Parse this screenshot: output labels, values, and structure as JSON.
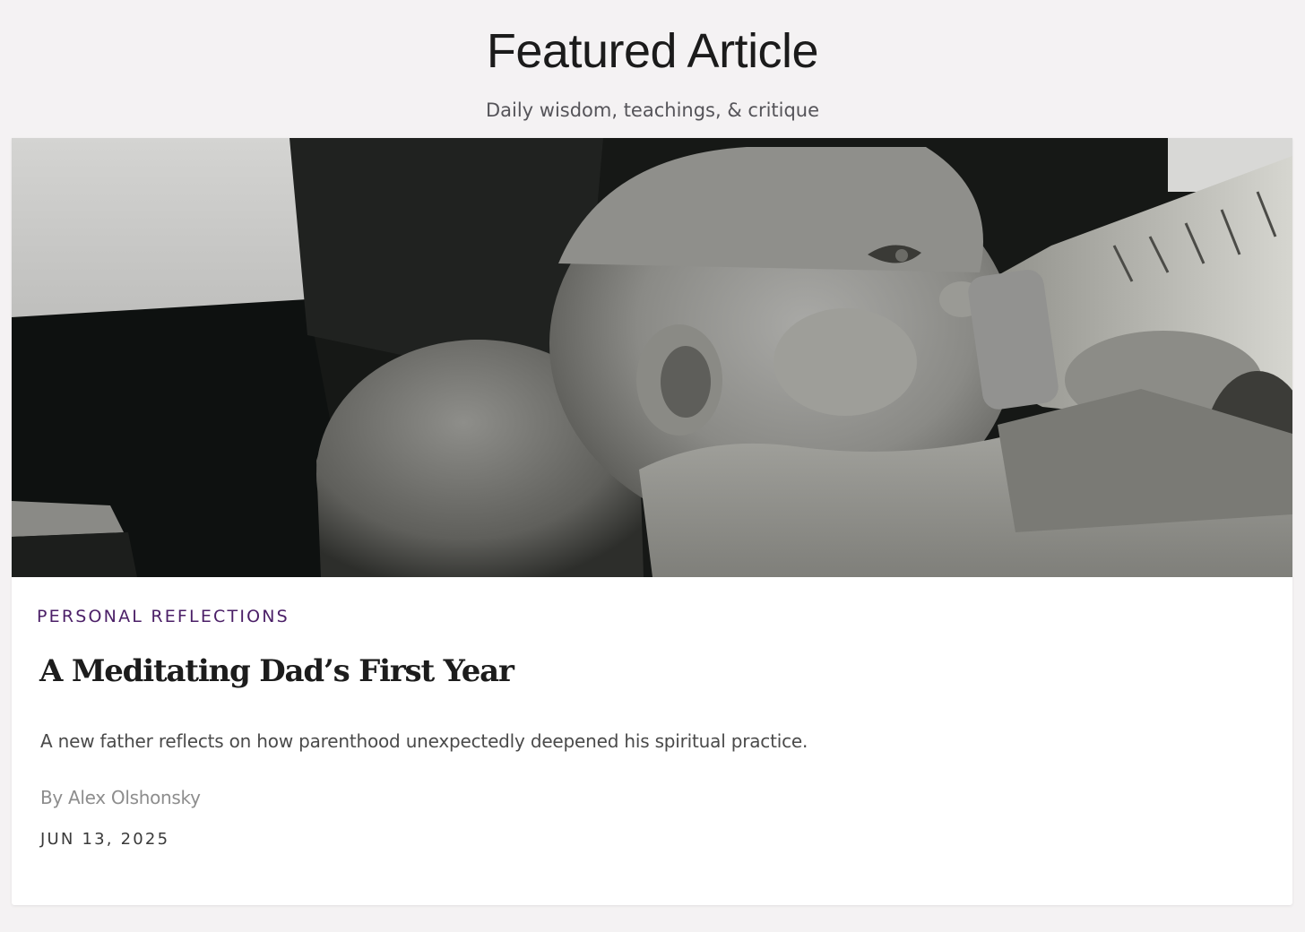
{
  "header": {
    "title": "Featured Article",
    "subtitle": "Daily wisdom, teachings, & critique"
  },
  "article": {
    "image_subject": "baby-bottle-feeding-photo",
    "category": "PERSONAL REFLECTIONS",
    "title": "A Meditating Dad’s First Year",
    "excerpt": "A new father reflects on how parenthood unexpectedly deepened his spiritual practice.",
    "byline": "By Alex Olshonsky",
    "date": "JUN 13, 2025"
  },
  "colors": {
    "page_background": "#f4f2f3",
    "card_background": "#ffffff",
    "category_accent": "#4b1f67",
    "title_text": "#1c1c1c",
    "muted_text": "#8d8d8d"
  }
}
